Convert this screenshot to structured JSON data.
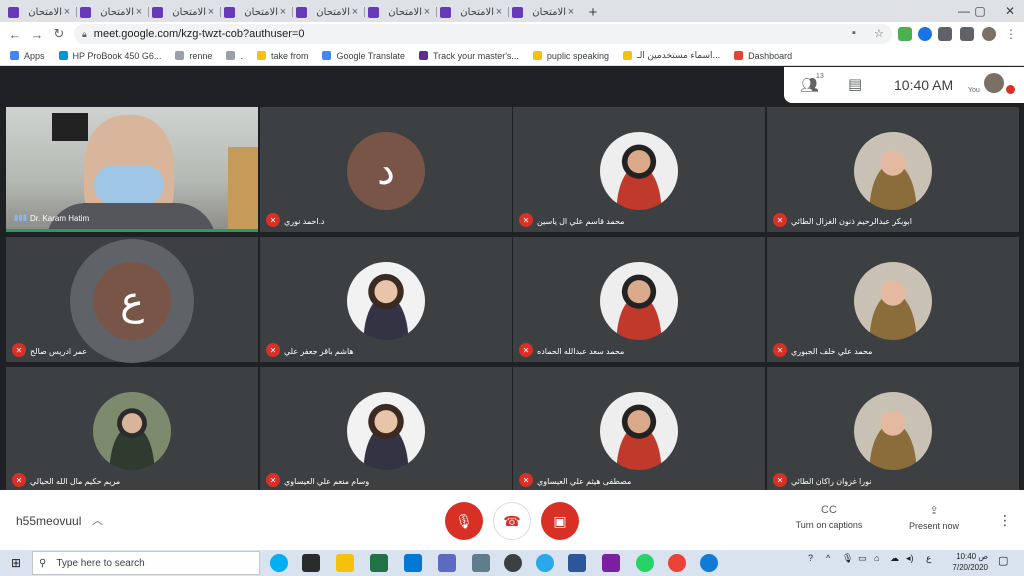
{
  "browser": {
    "tabs": [
      {
        "label": "الامتحان",
        "icon": "forms-icon",
        "active": false,
        "kind": "forms"
      },
      {
        "label": "الامتحان",
        "icon": "forms-icon",
        "active": false,
        "kind": "forms"
      },
      {
        "label": "Mee",
        "icon": "meet-icon",
        "active": true,
        "kind": "meet",
        "recording": true
      },
      {
        "label": "الامتحان",
        "icon": "forms-icon",
        "active": false,
        "kind": "forms"
      },
      {
        "label": "الامتحان",
        "icon": "forms-icon",
        "active": false,
        "kind": "forms"
      },
      {
        "label": "Mee",
        "icon": "meet-icon",
        "active": false,
        "kind": "meet",
        "recording": true
      },
      {
        "label": "الامتحان",
        "icon": "forms-icon",
        "active": false,
        "kind": "forms"
      },
      {
        "label": "الامتحان",
        "icon": "forms-icon",
        "active": false,
        "kind": "forms"
      },
      {
        "label": "Mee",
        "icon": "meet-icon",
        "active": false,
        "kind": "meet",
        "recording": true
      },
      {
        "label": "الامتحان",
        "icon": "forms-icon",
        "active": false,
        "kind": "forms"
      },
      {
        "label": "الامتحان",
        "icon": "forms-icon",
        "active": false,
        "kind": "forms"
      },
      {
        "label": "Mee",
        "icon": "meet-icon",
        "active": false,
        "kind": "meet",
        "recording": true
      }
    ],
    "url": "meet.google.com/kzg-twzt-cob?authuser=0",
    "bookmarks": [
      {
        "label": "Apps",
        "icon": "apps-grid-icon"
      },
      {
        "label": "HP ProBook 450 G6...",
        "icon": "hp-icon"
      },
      {
        "label": "renne",
        "icon": "page-icon"
      },
      {
        "label": ".",
        "icon": "page-icon"
      },
      {
        "label": "take from",
        "icon": "folder-icon"
      },
      {
        "label": "Google Translate",
        "icon": "translate-icon"
      },
      {
        "label": "Track your master's...",
        "icon": "m-icon"
      },
      {
        "label": "puplic speaking",
        "icon": "folder-icon"
      },
      {
        "label": "اسماء مستخدمين الـ...",
        "icon": "folder-icon"
      },
      {
        "label": "Dashboard",
        "icon": "google-icon"
      }
    ]
  },
  "meet": {
    "participant_count": "13",
    "time": "10:40 AM",
    "self_label": "You",
    "speaker": {
      "name": "Dr. Karam Hatim"
    },
    "participants": [
      {
        "name": "د.احمد نوري",
        "initial": "د",
        "type": "letter"
      },
      {
        "name": "محمد قاسم علي ال ياسين",
        "type": "photo"
      },
      {
        "name": "ابوبكر عبدالرحيم ذنون الغزال الطائي",
        "type": "photo"
      },
      {
        "name": "عمر ادريس صالح",
        "initial": "ع",
        "type": "letter-ring"
      },
      {
        "name": "هاشم باقر جعفر علي",
        "type": "photo"
      },
      {
        "name": "محمد سعد عبدالله الحماده",
        "type": "photo"
      },
      {
        "name": "محمد علي خلف الجبوري",
        "type": "photo"
      },
      {
        "name": "مريم حكيم مال الله الحيالي",
        "type": "photo"
      },
      {
        "name": "وسام منعم علي العيساوي",
        "type": "photo"
      },
      {
        "name": "مصطفى هيثم علي العيساوي",
        "type": "photo"
      },
      {
        "name": "نورا غزوان راكان الطائي",
        "type": "photo"
      }
    ],
    "meeting_code": "h55meovuul",
    "captions_label": "Turn on captions",
    "present_label": "Present now"
  },
  "taskbar": {
    "search_placeholder": "Type here to search",
    "time": "10:40 ص",
    "date": "7/20/2020",
    "lang": "ع"
  },
  "colors": {
    "accent_red": "#d93025",
    "speaker_green": "#1aa260",
    "tile_bg": "#3c4043",
    "meet_bg": "#202124"
  }
}
